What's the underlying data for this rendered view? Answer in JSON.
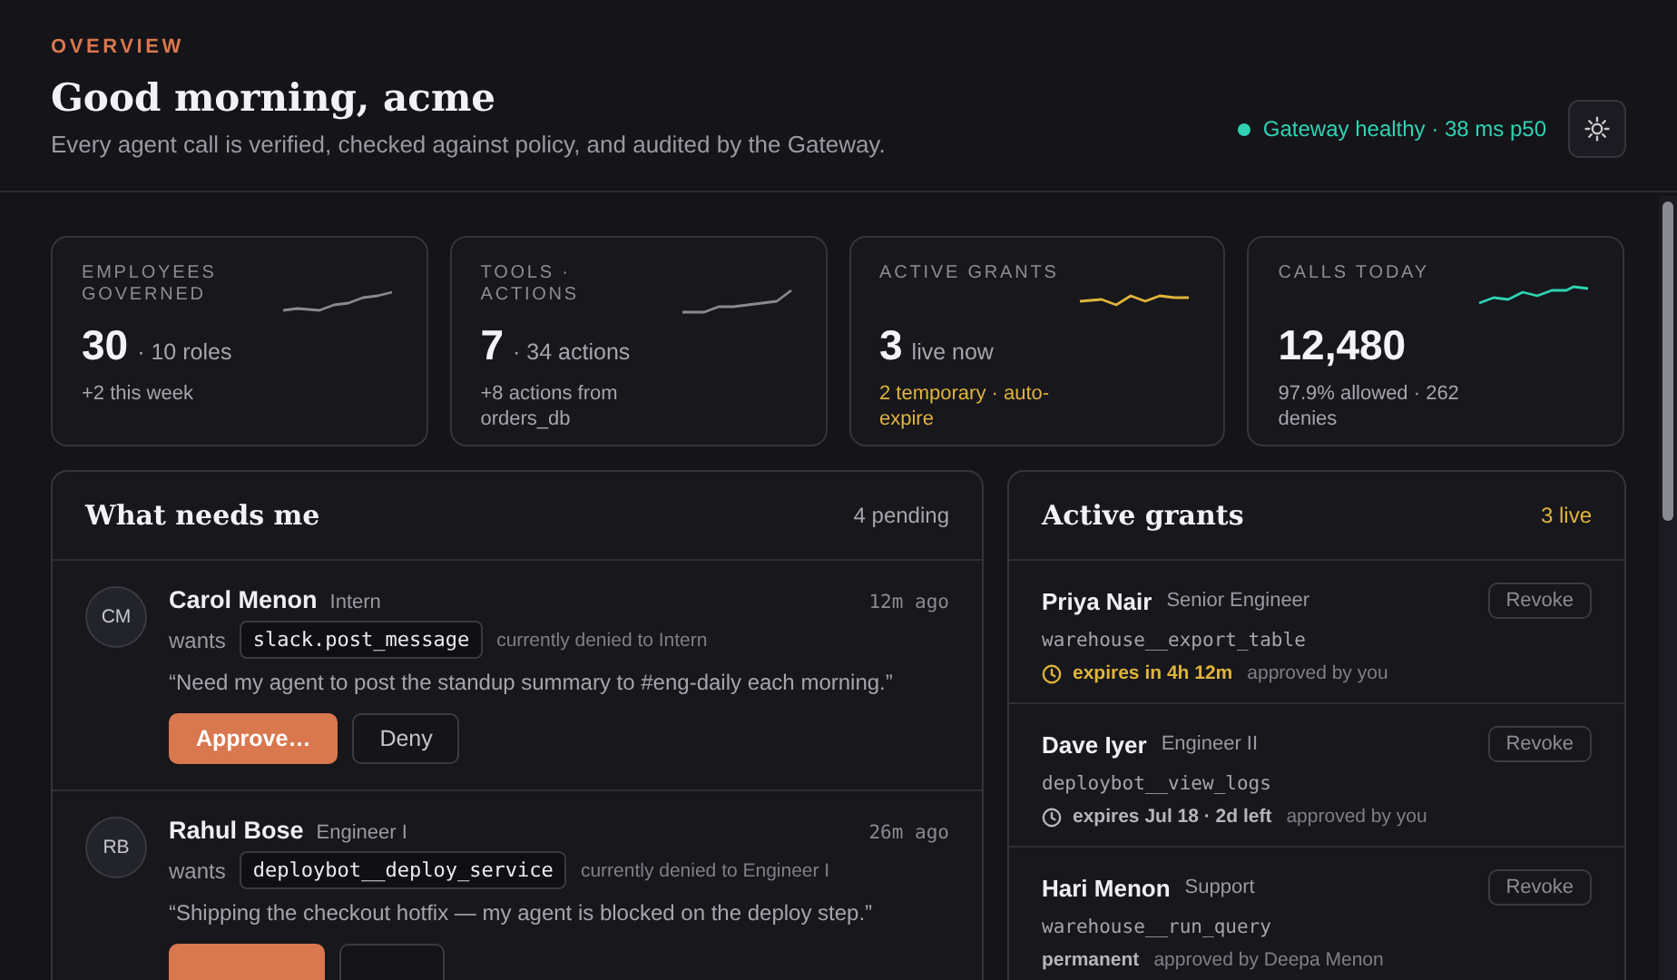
{
  "header": {
    "eyebrow": "OVERVIEW",
    "title": "Good morning, acme",
    "subtitle": "Every agent call is verified, checked against policy, and audited by the Gateway.",
    "status": {
      "text": "Gateway healthy · 38 ms p50",
      "healthy": true
    }
  },
  "stats": [
    {
      "label": "EMPLOYEES GOVERNED",
      "value": "30",
      "unit": "· 10 roles",
      "note": "+2 this week",
      "note_highlight": false,
      "color": "#8a8a93"
    },
    {
      "label": "TOOLS · ACTIONS",
      "value": "7",
      "unit": "· 34 actions",
      "note": "+8 actions from orders_db",
      "note_highlight": false,
      "color": "#8a8a93"
    },
    {
      "label": "ACTIVE GRANTS",
      "value": "3",
      "unit": "live now",
      "note": "2 temporary · auto-expire",
      "note_highlight": true,
      "color": "#e0b43a"
    },
    {
      "label": "CALLS TODAY",
      "value": "12,480",
      "note": "97.9% allowed · 262 denies",
      "note_highlight": false,
      "color": "#2fd3b3"
    }
  ],
  "requests": {
    "title": "What needs me",
    "count": "4 pending",
    "items": [
      {
        "initials": "CM",
        "name": "Carol Menon",
        "role": "Intern",
        "time": "12m ago",
        "wants": "wants",
        "action": "slack.post_message",
        "policy": "currently denied to Intern",
        "quote": "“Need my agent to post the standup summary to #eng-daily each morning.”",
        "buttons": [
          {
            "kind": "primary",
            "label": "Approve…"
          },
          {
            "kind": "secondary",
            "label": "Deny"
          }
        ]
      },
      {
        "initials": "RB",
        "name": "Rahul Bose",
        "role": "Engineer I",
        "time": "26m ago",
        "wants": "wants",
        "action": "deploybot__deploy_service",
        "policy": "currently denied to Engineer I",
        "quote": "“Shipping the checkout hotfix — my agent is blocked on the deploy step.”",
        "buttons": [
          {
            "kind": "primary"
          },
          {
            "kind": "secondary"
          }
        ]
      }
    ]
  },
  "grants": {
    "title": "Active grants",
    "count": "3 live",
    "items": [
      {
        "name": "Priya Nair",
        "role": "Senior Engineer",
        "revoke": "Revoke",
        "action": "warehouse__export_table",
        "expiry": {
          "kind": "temporary",
          "urgent": true,
          "text": "expires in 4h 12m"
        },
        "approver": "approved by you"
      },
      {
        "name": "Dave Iyer",
        "role": "Engineer II",
        "revoke": "Revoke",
        "action": "deploybot__view_logs",
        "expiry": {
          "kind": "temporary",
          "urgent": false,
          "text": "expires Jul 18 · 2d left"
        },
        "approver": "approved by you"
      },
      {
        "name": "Hari Menon",
        "role": "Support",
        "revoke": "Revoke",
        "action": "warehouse__run_query",
        "expiry": {
          "kind": "permanent",
          "text": "permanent"
        },
        "approver": "approved by Deepa Menon"
      }
    ]
  }
}
